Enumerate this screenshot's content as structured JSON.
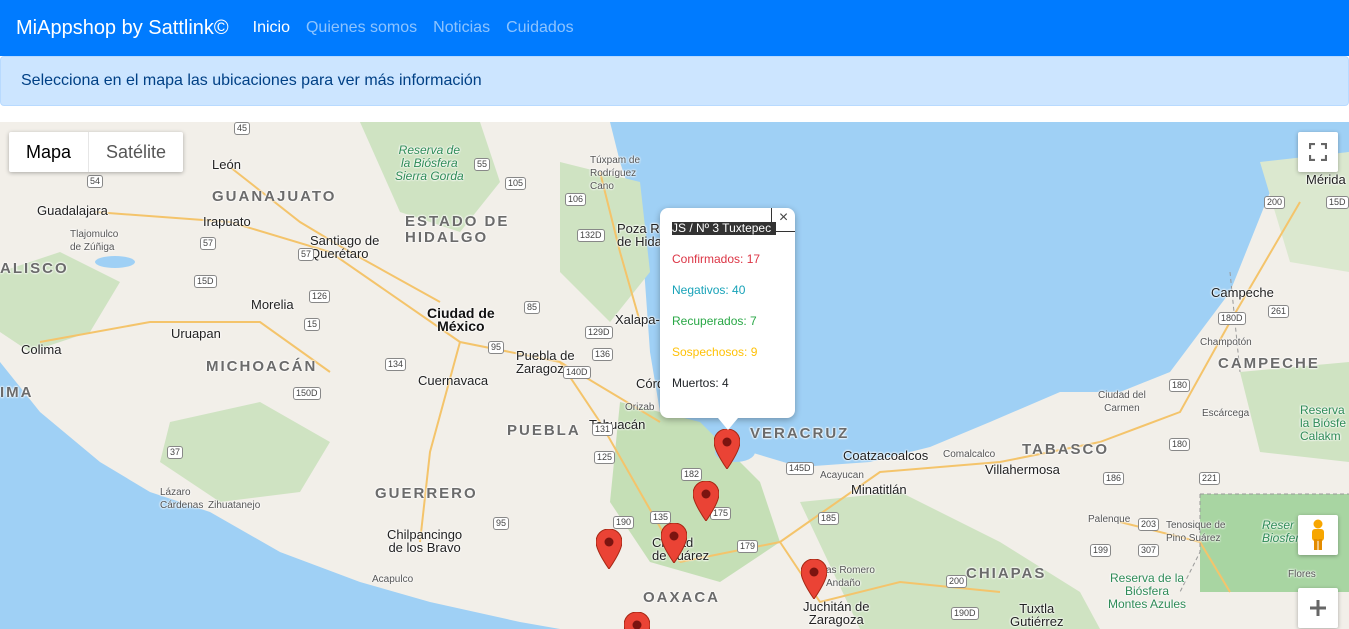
{
  "navbar": {
    "brand": "MiAppshop by Sattlink©",
    "links": [
      "Inicio",
      "Quienes somos",
      "Noticias",
      "Cuidados"
    ]
  },
  "alert": {
    "text": "Selecciona en el mapa las ubicaciones para ver más información"
  },
  "map": {
    "map_type": [
      "Mapa",
      "Satélite"
    ],
    "labels": {
      "leon": "León",
      "guanajuato": "GUANAJUATO",
      "guadalajara": "Guadalajara",
      "tlajomulco": "Tlajomulco\nde Zúñiga",
      "irapuato": "Irapuato",
      "jalisco": "ALISCO",
      "santiago": "Santiago de\nQuerétaro",
      "estado_hidalgo": "ESTADO DE\nHIDALGO",
      "reserva_sierra_gorda": "Reserva de\nla Biósfera\nSierra Gorda",
      "tuxpam": "Túxpam de\nRodríguez\nCano",
      "poza_rica": "Poza Rica\nde Hida",
      "morelia": "Morelia",
      "uruapan": "Uruapan",
      "colima": "Colima",
      "ciudad_mexico": "Ciudad de\nMéxico",
      "xalapa": "Xalapa-",
      "puebla": "Puebla de\nZaragoza",
      "michoacan": "MICHOACÁN",
      "cuernavaca": "Cuernavaca",
      "cordoba": "Córd",
      "orizaba": "Orizab",
      "ima": "IMA",
      "puebla_state": "PUEBLA",
      "tehuacan": "Tehuacán",
      "veracruz": "VERACRUZ",
      "coatzacoalcos": "Coatzacoalcos",
      "tabasco": "TABASCO",
      "villahermosa": "Villahermosa",
      "comalcalco": "Comalcalco",
      "acayucan": "Acayucan",
      "minatitlan": "Minatitlán",
      "guerrero": "GUERRERO",
      "lazaro": "Lázaro\nCárdenas",
      "zihuatanejo": "Zihuatanejo",
      "chilpancingo": "Chilpancingo\nde los Bravo",
      "acapulco": "Acapulco",
      "oaxaca_city": "Ciudad\nde Juárez",
      "oaxaca": "OAXACA",
      "matias_romero": "as Romero\nAndaño",
      "juchitan": "Juchitán de\nZaragoza",
      "chiapas": "CHIAPAS",
      "tuxtla": "Tuxtla\nGutiérrez",
      "reserva_montes": "Reserva de la\nBiósfera\nMontes Azules",
      "palenque": "Palenque",
      "tenosique": "Tenosique de\nPino Suárez",
      "reserva_biosf": "Reser\nBiosfer",
      "flores": "Flores",
      "merida": "Mérida",
      "campeche": "Campeche",
      "champoton": "Champotón",
      "campeche_state": "CAMPECHE",
      "ciudad_carmen": "Ciudad del\nCarmen",
      "escarcega": "Escárcega",
      "reserva_calak": "Reserva\nla Biósfe\nCalakm"
    },
    "shields": [
      "54",
      "45",
      "15D",
      "57",
      "126",
      "15",
      "134",
      "95",
      "55",
      "105",
      "106",
      "132D",
      "85",
      "129D",
      "140D",
      "136",
      "150D",
      "131",
      "125",
      "135",
      "175",
      "190",
      "95",
      "180",
      "182",
      "145D",
      "185",
      "179",
      "200",
      "190D",
      "199",
      "307",
      "203",
      "186",
      "180D",
      "261",
      "180",
      "37",
      "200",
      "15D",
      "57",
      "221"
    ]
  },
  "infowindow": {
    "title": "JS / Nº 3 Tuxtepec",
    "confirmados": "Confirmados: 17",
    "negativos": "Negativos: 40",
    "recuperados": "Recuperados: 7",
    "sospechosos": "Sospechosos: 9",
    "muertos": "Muertos: 4",
    "close": "×"
  },
  "colors": {
    "primary": "#007bff",
    "confirmados": "#dc3545",
    "negativos": "#17a2b8",
    "recuperados": "#28a745",
    "sospechosos": "#ffc107",
    "muertos": "#212529"
  }
}
